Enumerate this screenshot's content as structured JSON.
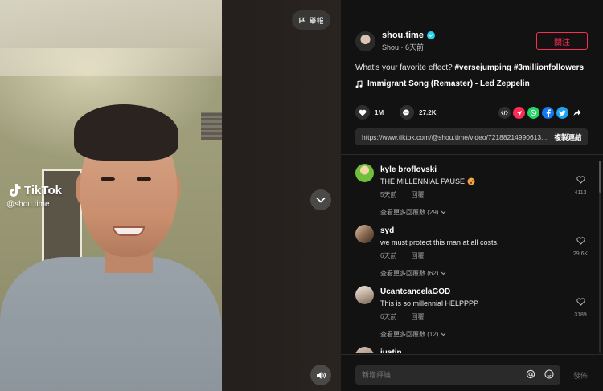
{
  "video": {
    "report_label": "舉報",
    "watermark_brand": "TikTok",
    "watermark_handle": "@shou.time"
  },
  "author": {
    "username": "shou.time",
    "subtitle": "Shou · 6天前",
    "follow_label": "關注"
  },
  "post": {
    "caption_text": "What's your favorite effect?",
    "hashtags": "#versejumping #3millionfollowers",
    "music": "Immigrant Song (Remaster) - Led Zeppelin"
  },
  "actions": {
    "likes": "1M",
    "comments": "27.2K"
  },
  "link": {
    "url": "https://www.tiktok.com/@shou.time/video/72188214990613...",
    "copy_label": "複製連結"
  },
  "comments": [
    {
      "user": "kyle broflovski",
      "text": "THE MILLENNIAL PAUSE",
      "time": "5天前",
      "reply_label": "回覆",
      "more": "查看更多回覆數 (29)",
      "likes": "4113",
      "avatar_color": "#6fbf3a"
    },
    {
      "user": "syd",
      "text": "we must protect this man at all costs.",
      "time": "6天前",
      "reply_label": "回覆",
      "more": "查看更多回覆數 (62)",
      "likes": "29.6K",
      "avatar_color": "#8a6a52"
    },
    {
      "user": "UcantcancelaGOD",
      "text": "This is so millennial HELPPPP",
      "time": "6天前",
      "reply_label": "回覆",
      "more": "查看更多回覆數 (12)",
      "likes": "3189",
      "avatar_color": "#c9b8a8"
    },
    {
      "user": "justin",
      "text": "",
      "time": "",
      "reply_label": "",
      "more": "",
      "likes": "",
      "avatar_color": "#a89080"
    }
  ],
  "composer": {
    "placeholder": "新增評論...",
    "post_label": "發佈"
  },
  "colors": {
    "accent": "#fe2c55",
    "verified": "#20d5ec",
    "panel_bg": "#121212"
  }
}
